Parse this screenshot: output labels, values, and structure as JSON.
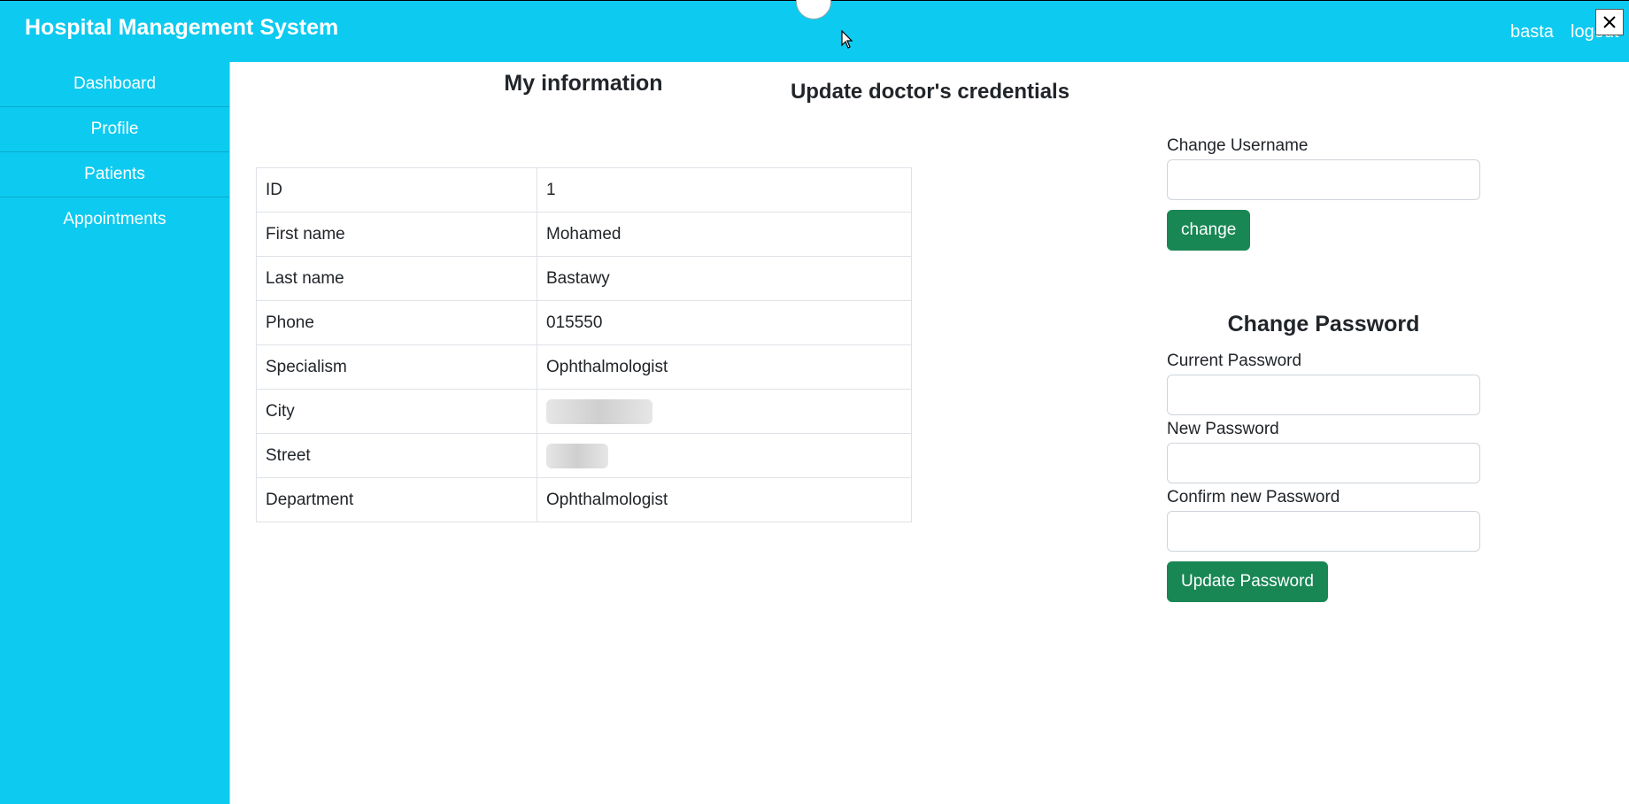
{
  "header": {
    "brand": "Hospital Management System",
    "user": "basta",
    "logout": "logout"
  },
  "sidebar": {
    "items": [
      {
        "label": "Dashboard"
      },
      {
        "label": "Profile"
      },
      {
        "label": "Patients"
      },
      {
        "label": "Appointments"
      }
    ]
  },
  "main": {
    "page_title": "Update doctor's credentials",
    "info_title": "My information",
    "info_rows": [
      {
        "key": "ID",
        "value": "1"
      },
      {
        "key": "First name",
        "value": "Mohamed"
      },
      {
        "key": "Last name",
        "value": "Bastawy"
      },
      {
        "key": "Phone",
        "value": "015550"
      },
      {
        "key": "Specialism",
        "value": "Ophthalmologist"
      },
      {
        "key": "City",
        "value": ""
      },
      {
        "key": "Street",
        "value": ""
      },
      {
        "key": "Department",
        "value": "Ophthalmologist"
      }
    ]
  },
  "username_form": {
    "label": "Change Username",
    "value": "",
    "button": "change"
  },
  "password_form": {
    "title": "Change Password",
    "current_label": "Current Password",
    "new_label": "New Password",
    "confirm_label": "Confirm new Password",
    "button": "Update Password"
  },
  "colors": {
    "accent": "#0dcaf0",
    "button": "#198754"
  },
  "icons": {
    "close": "close-icon",
    "cursor": "mouse-cursor-icon"
  }
}
